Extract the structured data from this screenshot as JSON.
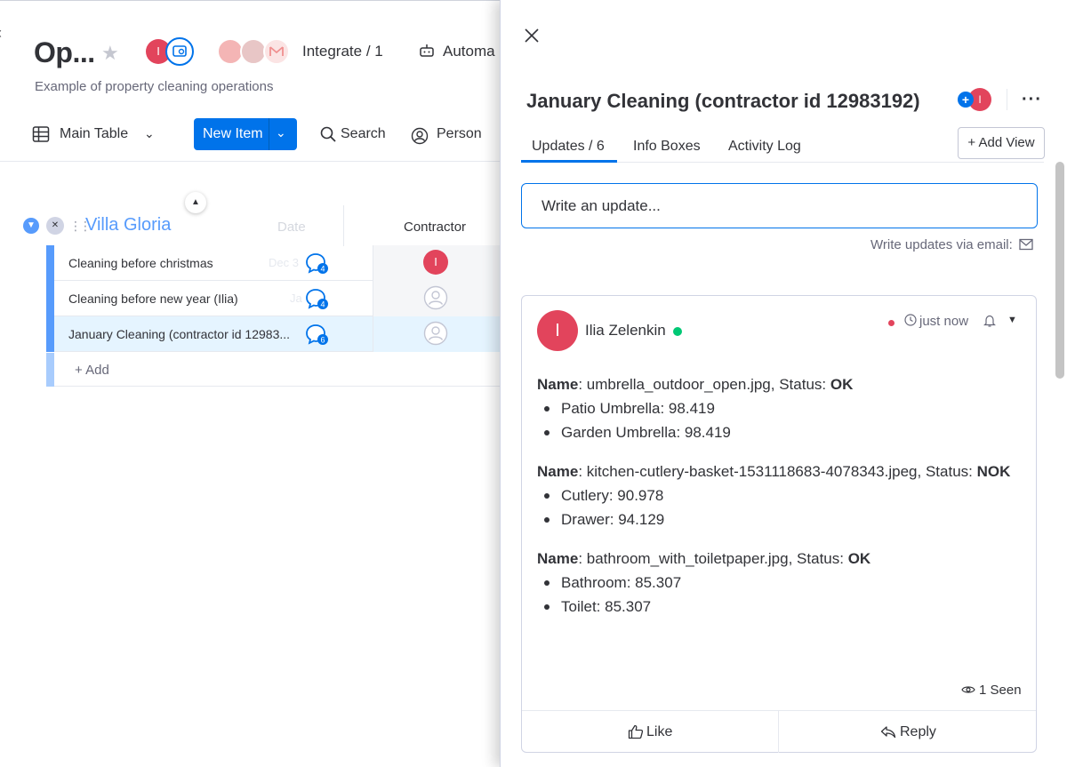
{
  "board": {
    "title": "Op...",
    "description": "Example of property cleaning operations",
    "owner_initial": "I",
    "integrate_label": "Integrate / 1",
    "automate_label": "Automa",
    "toolbar": {
      "main_table": "Main Table",
      "new_item": "New Item",
      "search": "Search",
      "person": "Person"
    },
    "group": {
      "title": "Villa Gloria",
      "color": "#579bfc",
      "date_header": "Date",
      "contractor_header": "Contractor"
    },
    "items": [
      {
        "name": "Cleaning before christmas",
        "date": "Dec 3",
        "updates": "4",
        "contractor": "I"
      },
      {
        "name": "Cleaning before new year (Ilia)",
        "date": "Ja",
        "updates": "4",
        "contractor": ""
      },
      {
        "name": "January Cleaning (contractor id 12983...",
        "date": "",
        "updates": "6",
        "contractor": ""
      }
    ],
    "add_label": "+ Add"
  },
  "panel": {
    "title": "January Cleaning (contractor id 12983192)",
    "subscriber_initial": "I",
    "tabs": [
      {
        "label": "Updates / 6",
        "active": true
      },
      {
        "label": "Info Boxes",
        "active": false
      },
      {
        "label": "Activity Log",
        "active": false
      }
    ],
    "add_view": "+ Add View",
    "update_placeholder": "Write an update...",
    "email_updates": "Write updates via email:",
    "post": {
      "author": "Ilia Zelenkin",
      "author_initial": "I",
      "time": "just now",
      "entries": [
        {
          "label": "Name",
          "filename": "umbrella_outdoor_open.jpg",
          "status_label": "Status",
          "status": "OK",
          "items": [
            "Patio Umbrella: 98.419",
            "Garden Umbrella: 98.419"
          ]
        },
        {
          "label": "Name",
          "filename": "kitchen-cutlery-basket-1531118683-4078343.jpeg",
          "status_label": "Status",
          "status": "NOK",
          "items": [
            "Cutlery: 90.978",
            "Drawer: 94.129"
          ]
        },
        {
          "label": "Name",
          "filename": "bathroom_with_toiletpaper.jpg",
          "status_label": "Status",
          "status": "OK",
          "items": [
            "Bathroom: 85.307",
            "Toilet: 85.307"
          ]
        }
      ],
      "seen": "1 Seen",
      "like": "Like",
      "reply": "Reply"
    }
  },
  "colors": {
    "primary": "#0073ea",
    "avatar_red": "#e2445c",
    "online_green": "#00c875",
    "text": "#323338",
    "muted": "#676879"
  }
}
